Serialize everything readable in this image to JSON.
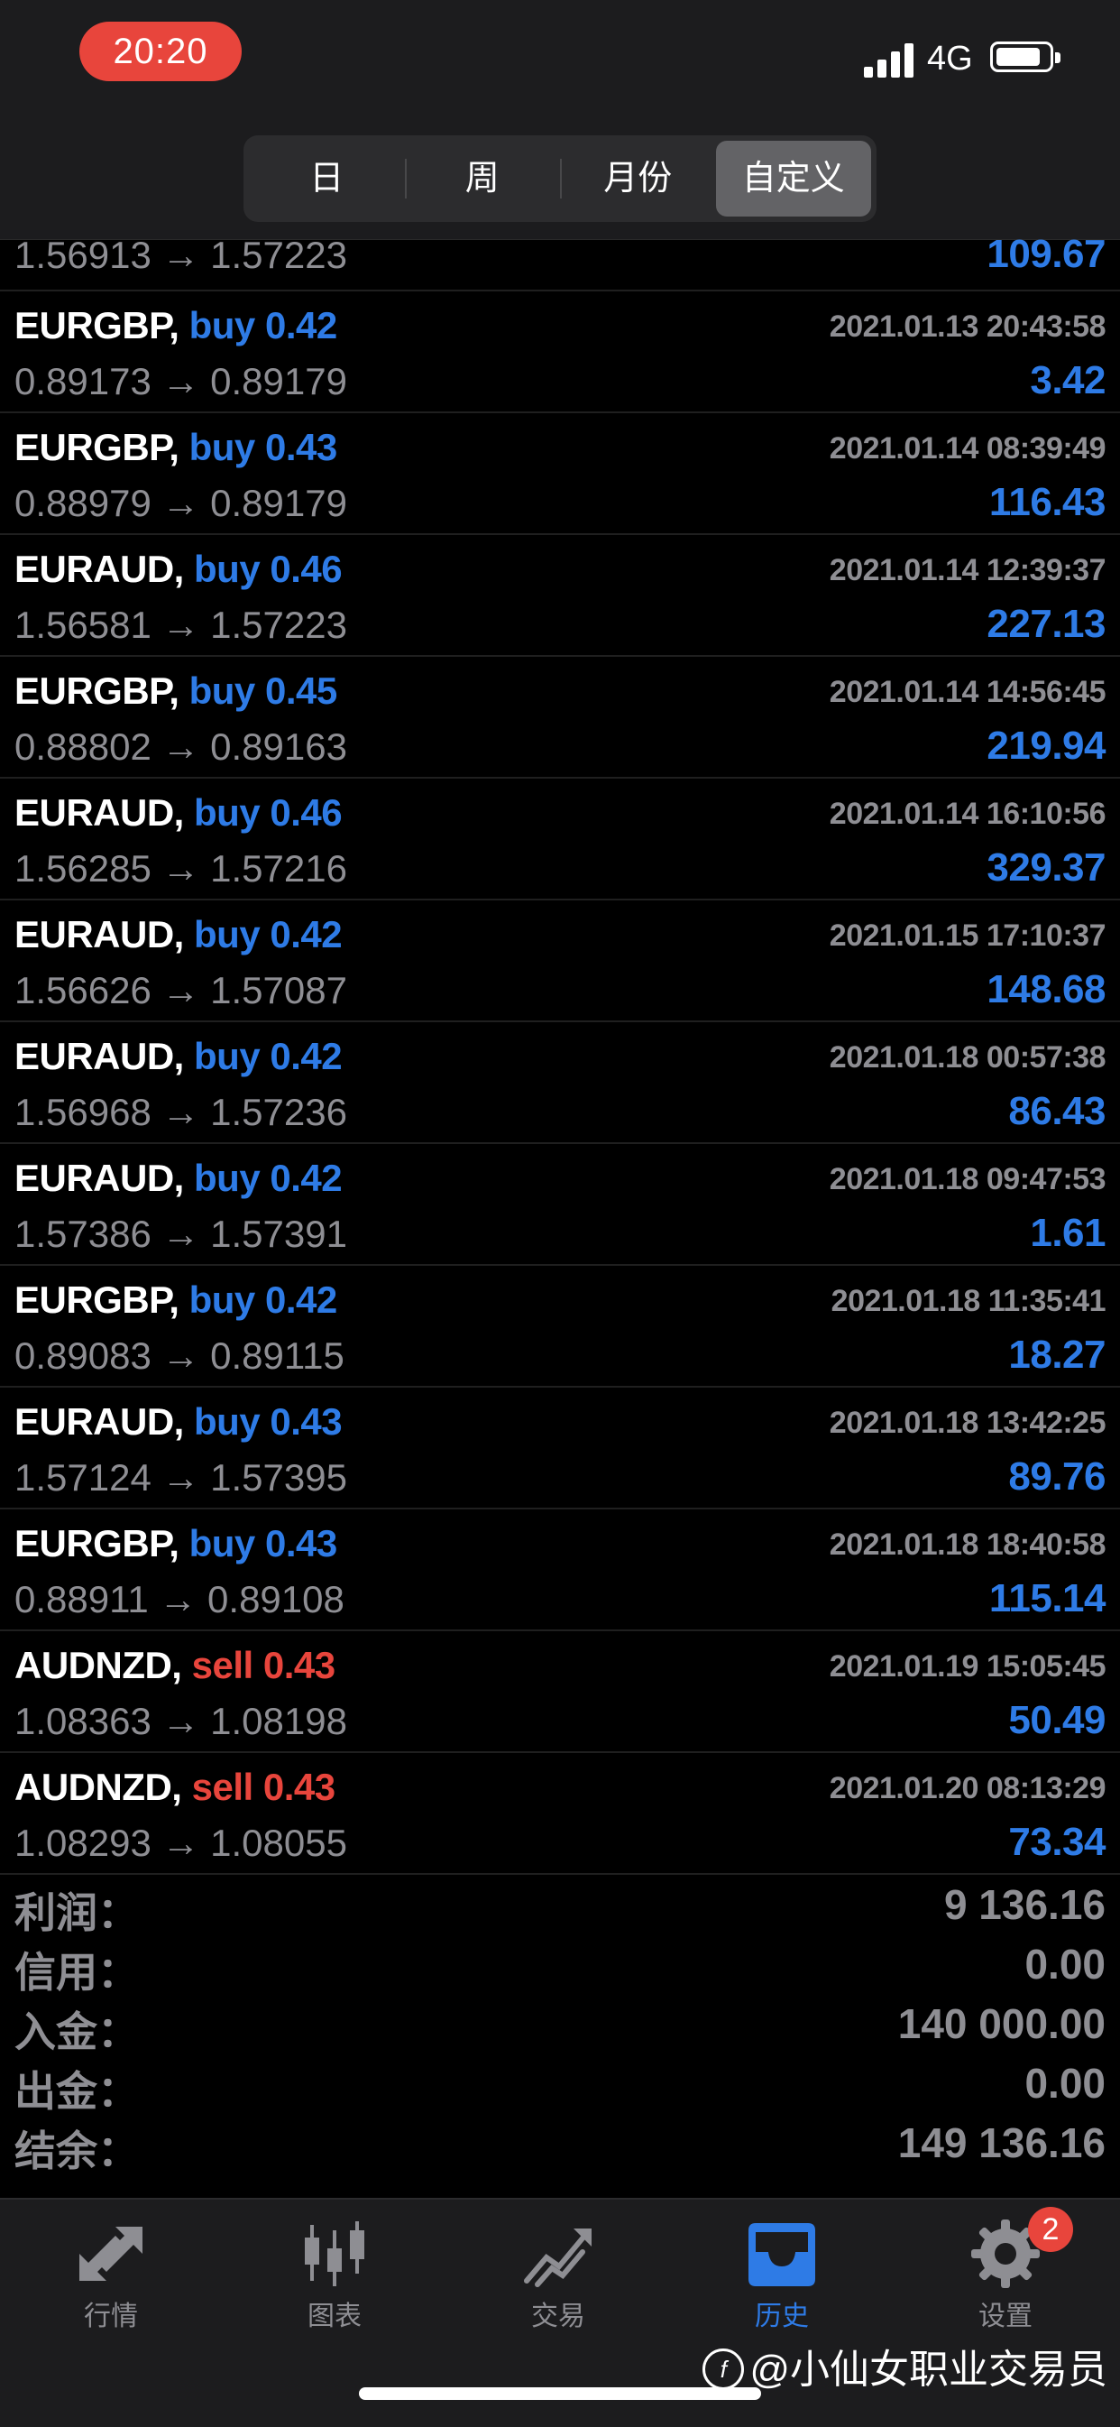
{
  "status_bar": {
    "time": "20:20",
    "network": "4G"
  },
  "header": {
    "segments": [
      {
        "label": "日",
        "active": false
      },
      {
        "label": "周",
        "active": false
      },
      {
        "label": "月份",
        "active": false
      },
      {
        "label": "自定义",
        "active": true
      }
    ]
  },
  "partial_row": {
    "prices": "1.56913 → 1.57223",
    "profit": "109.67"
  },
  "trades": [
    {
      "symbol": "EURGBP,",
      "side": "buy",
      "volume": "0.42",
      "datetime": "2021.01.13 20:43:58",
      "prices": "0.89173 → 0.89179",
      "profit": "3.42"
    },
    {
      "symbol": "EURGBP,",
      "side": "buy",
      "volume": "0.43",
      "datetime": "2021.01.14 08:39:49",
      "prices": "0.88979 → 0.89179",
      "profit": "116.43"
    },
    {
      "symbol": "EURAUD,",
      "side": "buy",
      "volume": "0.46",
      "datetime": "2021.01.14 12:39:37",
      "prices": "1.56581 → 1.57223",
      "profit": "227.13"
    },
    {
      "symbol": "EURGBP,",
      "side": "buy",
      "volume": "0.45",
      "datetime": "2021.01.14 14:56:45",
      "prices": "0.88802 → 0.89163",
      "profit": "219.94"
    },
    {
      "symbol": "EURAUD,",
      "side": "buy",
      "volume": "0.46",
      "datetime": "2021.01.14 16:10:56",
      "prices": "1.56285 → 1.57216",
      "profit": "329.37"
    },
    {
      "symbol": "EURAUD,",
      "side": "buy",
      "volume": "0.42",
      "datetime": "2021.01.15 17:10:37",
      "prices": "1.56626 → 1.57087",
      "profit": "148.68"
    },
    {
      "symbol": "EURAUD,",
      "side": "buy",
      "volume": "0.42",
      "datetime": "2021.01.18 00:57:38",
      "prices": "1.56968 → 1.57236",
      "profit": "86.43"
    },
    {
      "symbol": "EURAUD,",
      "side": "buy",
      "volume": "0.42",
      "datetime": "2021.01.18 09:47:53",
      "prices": "1.57386 → 1.57391",
      "profit": "1.61"
    },
    {
      "symbol": "EURGBP,",
      "side": "buy",
      "volume": "0.42",
      "datetime": "2021.01.18 11:35:41",
      "prices": "0.89083 → 0.89115",
      "profit": "18.27"
    },
    {
      "symbol": "EURAUD,",
      "side": "buy",
      "volume": "0.43",
      "datetime": "2021.01.18 13:42:25",
      "prices": "1.57124 → 1.57395",
      "profit": "89.76"
    },
    {
      "symbol": "EURGBP,",
      "side": "buy",
      "volume": "0.43",
      "datetime": "2021.01.18 18:40:58",
      "prices": "0.88911 → 0.89108",
      "profit": "115.14"
    },
    {
      "symbol": "AUDNZD,",
      "side": "sell",
      "volume": "0.43",
      "datetime": "2021.01.19 15:05:45",
      "prices": "1.08363 → 1.08198",
      "profit": "50.49"
    },
    {
      "symbol": "AUDNZD,",
      "side": "sell",
      "volume": "0.43",
      "datetime": "2021.01.20 08:13:29",
      "prices": "1.08293 → 1.08055",
      "profit": "73.34"
    }
  ],
  "summary": [
    {
      "label": "利润：",
      "value": "9 136.16"
    },
    {
      "label": "信用：",
      "value": "0.00"
    },
    {
      "label": "入金：",
      "value": "140 000.00"
    },
    {
      "label": "出金：",
      "value": "0.00"
    },
    {
      "label": "结余：",
      "value": "149 136.16"
    }
  ],
  "tabbar": {
    "tabs": [
      {
        "label": "行情",
        "icon": "quotes-arrows-icon"
      },
      {
        "label": "图表",
        "icon": "candlestick-chart-icon"
      },
      {
        "label": "交易",
        "icon": "trade-chart-icon"
      },
      {
        "label": "历史",
        "icon": "history-inbox-icon",
        "active": true
      },
      {
        "label": "设置",
        "icon": "settings-gear-icon"
      }
    ],
    "settings_badge": "2"
  },
  "watermark": "@小仙女职业交易员",
  "colors": {
    "buy": "#2e7be6",
    "sell": "#e8453c",
    "muted": "#8e8e93",
    "active_tab": "#2e7be6"
  }
}
